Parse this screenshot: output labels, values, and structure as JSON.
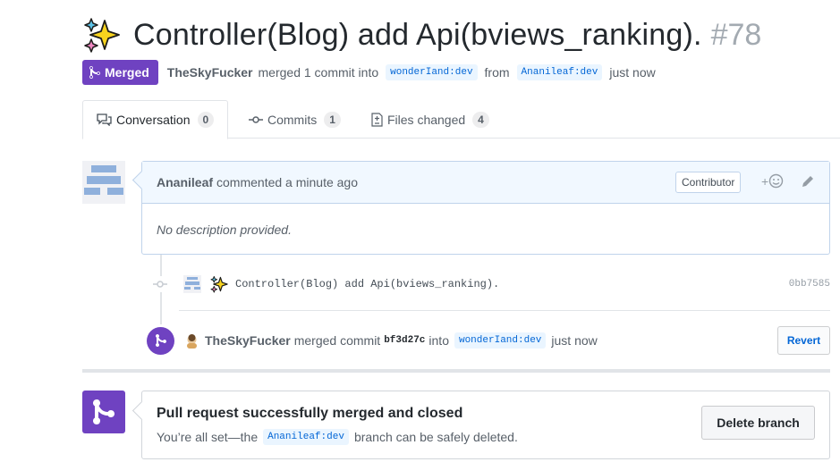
{
  "pr": {
    "title": "Controller(Blog) add Api(bviews_ranking).",
    "number": "#78",
    "title_icon": "sparkles-icon",
    "state": "Merged",
    "merger": "TheSkyFucker",
    "merged_text": "merged 1 commit into",
    "base_ref": "wonderIand:dev",
    "from_text": "from",
    "head_ref": "Ananileaf:dev",
    "time": "just now"
  },
  "tabs": [
    {
      "label": "Conversation",
      "count": "0",
      "icon": "comment-discussion-icon"
    },
    {
      "label": "Commits",
      "count": "1",
      "icon": "git-commit-icon"
    },
    {
      "label": "Files changed",
      "count": "4",
      "icon": "file-diff-icon"
    }
  ],
  "comment": {
    "author": "Ananileaf",
    "action": "commented a minute ago",
    "role_badge": "Contributor",
    "reaction_plus": "+",
    "body": "No description provided."
  },
  "commit": {
    "message": "Controller(Blog) add Api(bviews_ranking).",
    "sha": "0bb7585"
  },
  "merge_event": {
    "author": "TheSkyFucker",
    "text1": "merged commit",
    "sha": "bf3d27c",
    "text2": "into",
    "ref": "wonderIand:dev",
    "time": "just now",
    "revert_label": "Revert"
  },
  "merged_box": {
    "title": "Pull request successfully merged and closed",
    "sub_before": "You’re all set—the",
    "ref": "Ananileaf:dev",
    "sub_after": "branch can be safely deleted.",
    "delete_label": "Delete branch"
  },
  "colors": {
    "merged_purple": "#6f42c1",
    "link_blue": "#0366d6",
    "ref_bg": "#eaf5ff"
  }
}
